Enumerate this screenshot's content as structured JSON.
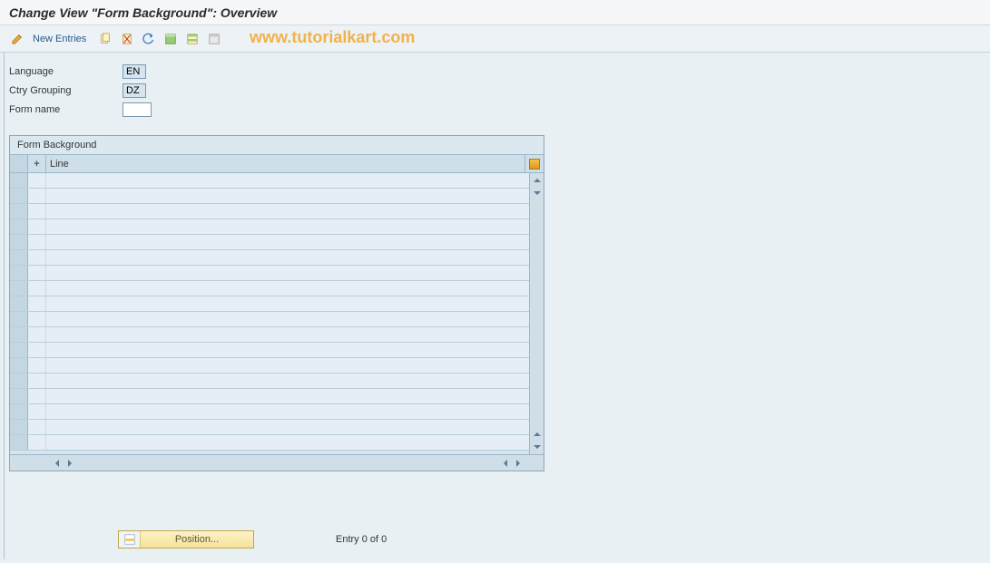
{
  "title": "Change View \"Form Background\": Overview",
  "toolbar": {
    "new_entries_label": "New Entries"
  },
  "watermark": "www.tutorialkart.com",
  "fields": {
    "language": {
      "label": "Language",
      "value": "EN"
    },
    "ctry_grouping": {
      "label": "Ctry Grouping",
      "value": "DZ"
    },
    "form_name": {
      "label": "Form name",
      "value": ""
    }
  },
  "table": {
    "panel_title": "Form Background",
    "col_plus": "+",
    "col_line": "Line",
    "rows": [
      {
        "sel": "",
        "plus": "",
        "line": ""
      },
      {
        "sel": "",
        "plus": "",
        "line": ""
      },
      {
        "sel": "",
        "plus": "",
        "line": ""
      },
      {
        "sel": "",
        "plus": "",
        "line": ""
      },
      {
        "sel": "",
        "plus": "",
        "line": ""
      },
      {
        "sel": "",
        "plus": "",
        "line": ""
      },
      {
        "sel": "",
        "plus": "",
        "line": ""
      },
      {
        "sel": "",
        "plus": "",
        "line": ""
      },
      {
        "sel": "",
        "plus": "",
        "line": ""
      },
      {
        "sel": "",
        "plus": "",
        "line": ""
      },
      {
        "sel": "",
        "plus": "",
        "line": ""
      },
      {
        "sel": "",
        "plus": "",
        "line": ""
      },
      {
        "sel": "",
        "plus": "",
        "line": ""
      },
      {
        "sel": "",
        "plus": "",
        "line": ""
      },
      {
        "sel": "",
        "plus": "",
        "line": ""
      },
      {
        "sel": "",
        "plus": "",
        "line": ""
      },
      {
        "sel": "",
        "plus": "",
        "line": ""
      },
      {
        "sel": "",
        "plus": "",
        "line": ""
      }
    ]
  },
  "footer": {
    "position_label": "Position...",
    "entry_label": "Entry 0 of 0"
  },
  "icons": {
    "edit": "pencil-icon",
    "copy": "copy-icon",
    "delete": "delete-icon",
    "undo": "undo-icon",
    "select_all": "select-all-icon",
    "select_block": "select-block-icon",
    "deselect": "deselect-icon",
    "config": "table-config-icon"
  }
}
